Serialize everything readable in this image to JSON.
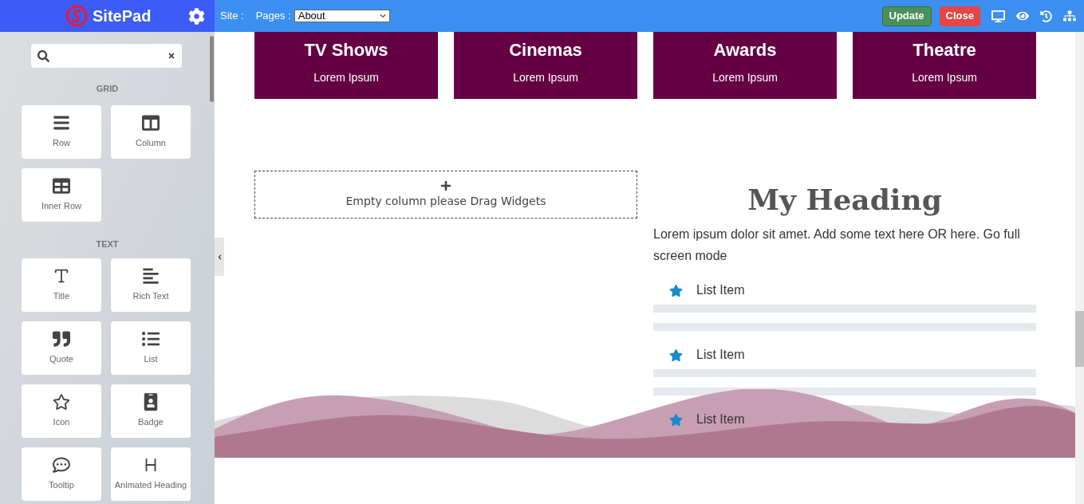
{
  "topbar": {
    "brand": "SitePad",
    "site_label": "Site :",
    "pages_label": "Pages :",
    "page_select": "About",
    "buttons": [
      {
        "label": "Update",
        "kind": "update"
      },
      {
        "label": "Close",
        "kind": "close"
      }
    ]
  },
  "sidebar": {
    "sections": [
      {
        "title": "GRID",
        "widgets": [
          {
            "label": "Row",
            "kind": "row"
          },
          {
            "label": "Column",
            "kind": "column"
          },
          {
            "label": "Inner Row",
            "kind": "inner_row"
          }
        ]
      },
      {
        "title": "TEXT",
        "widgets": [
          {
            "label": "Title",
            "kind": "title"
          },
          {
            "label": "Rich Text",
            "kind": "rich_text"
          },
          {
            "label": "Quote",
            "kind": "quote"
          },
          {
            "label": "List",
            "kind": "list"
          },
          {
            "label": "Icon",
            "kind": "icon"
          },
          {
            "label": "Badge",
            "kind": "badge"
          },
          {
            "label": "Tooltip",
            "kind": "tooltip"
          },
          {
            "label": "Animated Heading",
            "kind": "animated_heading"
          }
        ]
      }
    ]
  },
  "canvas": {
    "cards": [
      {
        "title": "TV Shows",
        "text": "Lorem Ipsum"
      },
      {
        "title": "Cinemas",
        "text": "Lorem Ipsum"
      },
      {
        "title": "Awards",
        "text": "Lorem Ipsum"
      },
      {
        "title": "Theatre",
        "text": "Lorem Ipsum"
      }
    ],
    "empty_column": "Empty column please Drag Widgets",
    "heading": "My Heading",
    "paragraph": "Lorem ipsum dolor sit amet. Add some text here OR here. Go full screen mode",
    "list": [
      "List Item",
      "List Item",
      "List Item"
    ]
  }
}
